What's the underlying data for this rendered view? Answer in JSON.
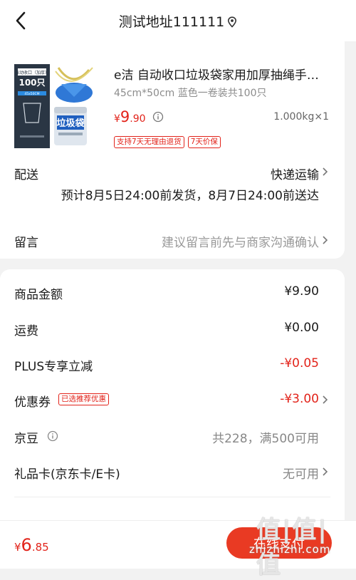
{
  "header": {
    "title": "测试地址111111"
  },
  "product": {
    "name": "e洁 自动收口垃圾袋家用加厚抽绳手提式穿绳背心式塑料袋",
    "spec": "45cm*50cm 蓝色一卷装共100只",
    "price_symbol": "¥",
    "price_int": "9",
    "price_dec": ".90",
    "weight": "1.000kg×1",
    "badges": [
      "支持7天无理由退货",
      "7天价保"
    ],
    "image_text": {
      "box_top": "自动收口（加厚）",
      "box_count": "100只",
      "box_size": "45x50CM",
      "can_label": "垃圾袋"
    }
  },
  "delivery": {
    "label": "配送",
    "method": "快递运输",
    "schedule": "预计8月5日24:00前发货，8月7日24:00前送达"
  },
  "message": {
    "label": "留言",
    "placeholder": "建议留言前先与商家沟通确认"
  },
  "summary": {
    "goods_label": "商品金额",
    "goods_value": "¥9.90",
    "shipping_label": "运费",
    "shipping_value": "¥0.00",
    "plus_label": "PLUS专享立减",
    "plus_value": "-¥0.05",
    "coupon_label": "优惠券",
    "coupon_badge": "已选推荐优惠",
    "coupon_value": "-¥3.00",
    "jingdou_label": "京豆",
    "jingdou_value": "共228，满500可用",
    "giftcard_label": "礼品卡(京东卡/E卡)",
    "giftcard_value": "无可用"
  },
  "footer": {
    "currency": "¥",
    "total_int": "6",
    "total_dec": ".85",
    "pay_label": "在线支付"
  },
  "watermark": {
    "top": "值|值|值",
    "bottom": "zhizhizhi.com"
  },
  "colors": {
    "accent": "#e2231a",
    "pay_button": "#e93a23"
  }
}
